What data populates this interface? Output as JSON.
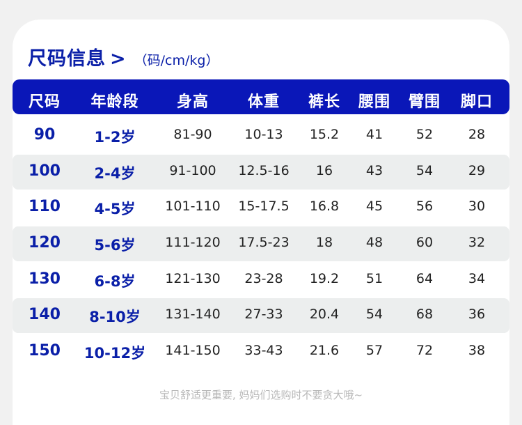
{
  "title": "尺码信息",
  "title_arrow": ">",
  "unit": "（码/cm/kg）",
  "headers": [
    "尺码",
    "年龄段",
    "身高",
    "体重",
    "裤长",
    "腰围",
    "臂围",
    "脚口"
  ],
  "rows": [
    [
      "90",
      "1-2岁",
      "81-90",
      "10-13",
      "15.2",
      "41",
      "52",
      "28"
    ],
    [
      "100",
      "2-4岁",
      "91-100",
      "12.5-16",
      "16",
      "43",
      "54",
      "29"
    ],
    [
      "110",
      "4-5岁",
      "101-110",
      "15-17.5",
      "16.8",
      "45",
      "56",
      "30"
    ],
    [
      "120",
      "5-6岁",
      "111-120",
      "17.5-23",
      "18",
      "48",
      "60",
      "32"
    ],
    [
      "130",
      "6-8岁",
      "121-130",
      "23-28",
      "19.2",
      "51",
      "64",
      "34"
    ],
    [
      "140",
      "8-10岁",
      "131-140",
      "27-33",
      "20.4",
      "54",
      "68",
      "36"
    ],
    [
      "150",
      "10-12岁",
      "141-150",
      "33-43",
      "21.6",
      "57",
      "72",
      "38"
    ]
  ],
  "footer": "宝贝舒适更重要, 妈妈们选购时不要贪大哦~",
  "colors": {
    "accent": "#0a17b8",
    "title": "#0a1fa8",
    "row_shade": "#eceeee"
  }
}
